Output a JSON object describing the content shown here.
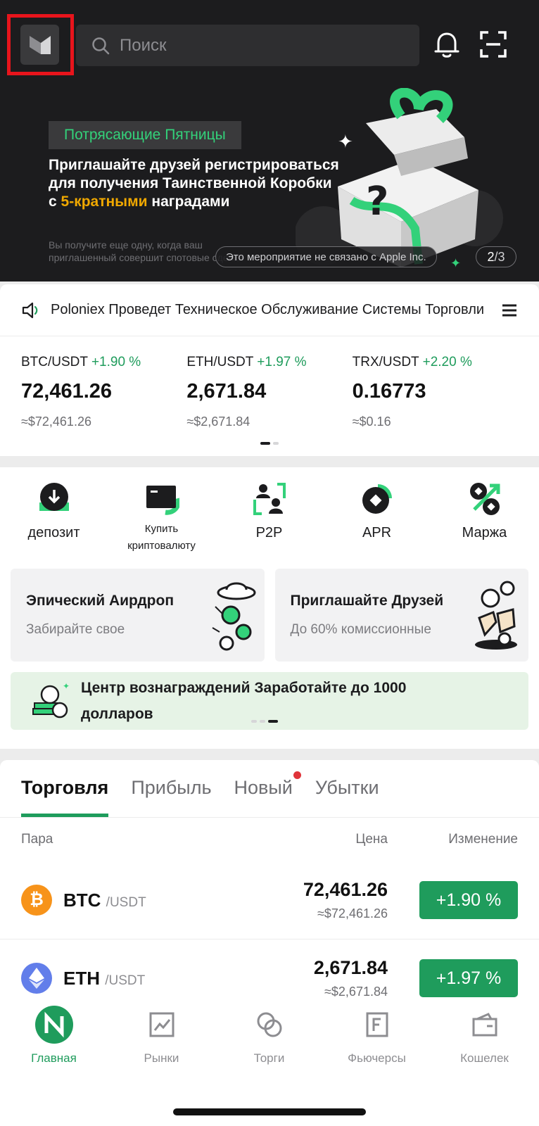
{
  "header": {
    "search_placeholder": "Поиск"
  },
  "banner": {
    "tag": "Потрясающие Пятницы",
    "headline_part1": "Приглашайте друзей регистрироваться для получения Таинственной Коробки с ",
    "headline_highlight": "5-кратными",
    "headline_part2": " наградами",
    "subtext": "Вы получите еще одну, когда ваш приглашенный совершит спотовые сделки",
    "disclaimer": "Это мероприятие не связано с Apple Inc.",
    "page_current": "2",
    "page_total": "/3"
  },
  "announcement": {
    "text": "Poloniex Проведет Техническое Обслуживание Системы Торговли"
  },
  "tickers": [
    {
      "pair": "BTC/USDT",
      "change": "+1.90 %",
      "price": "72,461.26",
      "usd": "≈$72,461.26"
    },
    {
      "pair": "ETH/USDT",
      "change": "+1.97 %",
      "price": "2,671.84",
      "usd": "≈$2,671.84"
    },
    {
      "pair": "TRX/USDT",
      "change": "+2.20 %",
      "price": "0.16773",
      "usd": "≈$0.16"
    }
  ],
  "quick_actions": [
    {
      "label": "депозит"
    },
    {
      "label": "Купить криптовалюту"
    },
    {
      "label": "P2P"
    },
    {
      "label": "APR"
    },
    {
      "label": "Маржа"
    }
  ],
  "promo_cards": [
    {
      "title": "Эпический Аирдроп",
      "subtitle": "Забирайте свое"
    },
    {
      "title": "Приглашайте Друзей",
      "subtitle": "До 60% комиссионные"
    }
  ],
  "reward_center": {
    "text": "Центр вознаграждений Заработайте до 1000 долларов"
  },
  "market": {
    "tabs": [
      "Торговля",
      "Прибыль",
      "Новый",
      "Убытки"
    ],
    "columns": {
      "pair": "Пара",
      "price": "Цена",
      "change": "Изменение"
    },
    "rows": [
      {
        "base": "BTC",
        "quote": "/USDT",
        "price": "72,461.26",
        "usd": "≈$72,461.26",
        "change": "+1.90 %",
        "coin_color": "#f7931a"
      },
      {
        "base": "ETH",
        "quote": "/USDT",
        "price": "2,671.84",
        "usd": "≈$2,671.84",
        "change": "+1.97 %",
        "coin_color": "#627eea"
      }
    ]
  },
  "bottom_nav": [
    {
      "label": "Главная",
      "icon": "home-logo-icon"
    },
    {
      "label": "Рынки",
      "icon": "chart-icon"
    },
    {
      "label": "Торги",
      "icon": "trade-icon"
    },
    {
      "label": "Фьючерсы",
      "icon": "futures-icon"
    },
    {
      "label": "Кошелек",
      "icon": "wallet-icon"
    }
  ],
  "colors": {
    "accent": "#1f9c5c",
    "highlight": "#f0a800",
    "selection_box": "#e8141c"
  }
}
